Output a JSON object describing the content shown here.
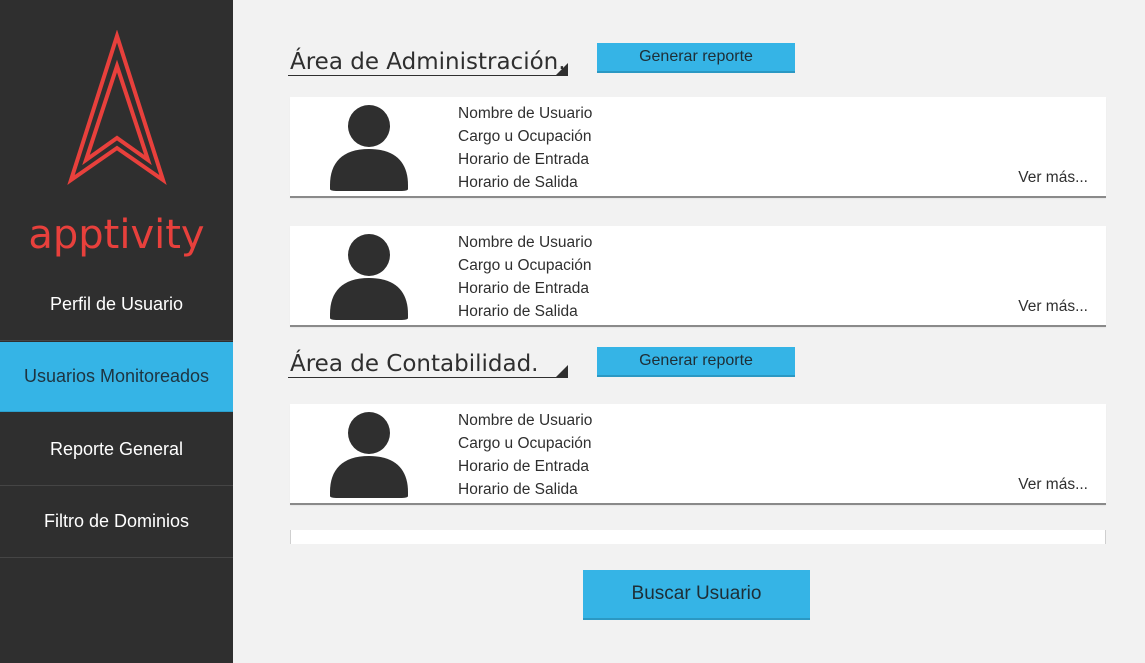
{
  "brand": {
    "name": "apptivity",
    "accent": "#e8403c"
  },
  "sidebar": {
    "items": [
      {
        "label": "Perfil de Usuario",
        "active": false
      },
      {
        "label": "Usuarios Monitoreados",
        "active": true
      },
      {
        "label": "Reporte General",
        "active": false
      },
      {
        "label": "Filtro de Dominios",
        "active": false
      }
    ]
  },
  "sections": [
    {
      "title": "Área de Administración.",
      "report_button": "Generar reporte",
      "users": [
        {
          "name": "Nombre de Usuario",
          "role": "Cargo u Ocupación",
          "entry": "Horario de Entrada",
          "exit": "Horario de Salida",
          "more": "Ver más..."
        },
        {
          "name": "Nombre de Usuario",
          "role": "Cargo u Ocupación",
          "entry": "Horario de Entrada",
          "exit": "Horario de Salida",
          "more": "Ver más..."
        }
      ]
    },
    {
      "title": "Área de Contabilidad.",
      "report_button": "Generar reporte",
      "users": [
        {
          "name": "Nombre de Usuario",
          "role": "Cargo u Ocupación",
          "entry": "Horario de Entrada",
          "exit": "Horario de Salida",
          "more": "Ver más..."
        }
      ]
    }
  ],
  "search_button": "Buscar Usuario",
  "colors": {
    "sidebar": "#2f2f2f",
    "primary": "#35b4e6",
    "background": "#f2f2f2"
  },
  "icons": {
    "avatar": "user-avatar-icon",
    "logo": "apptivity-logo-icon"
  }
}
